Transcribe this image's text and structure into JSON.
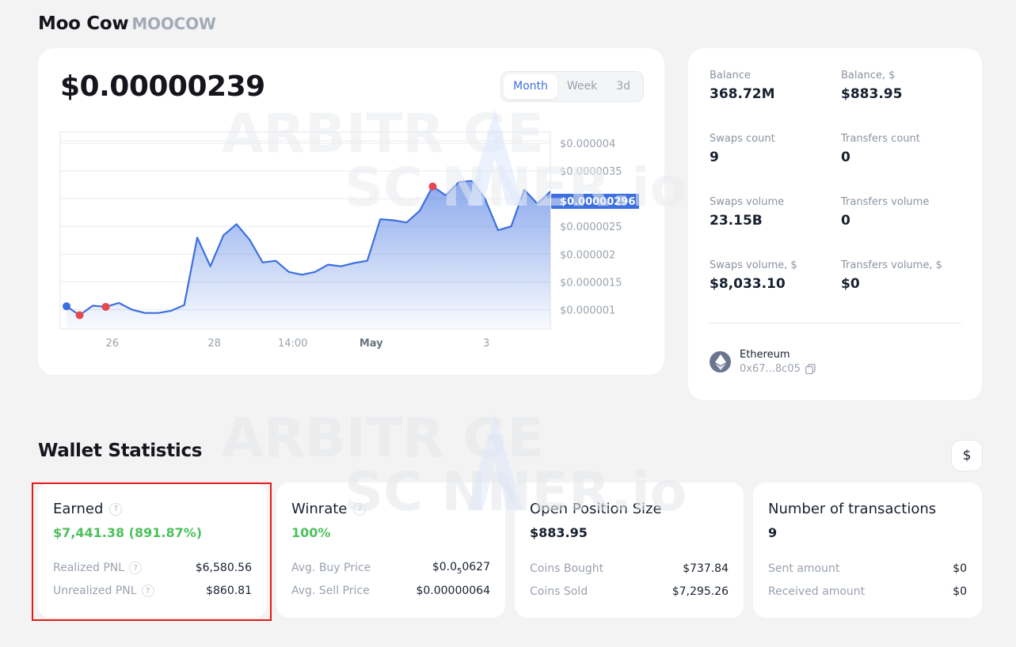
{
  "token": {
    "name": "Moo Cow",
    "symbol": "MOOCOW"
  },
  "price": "$0.00000239",
  "range_tabs": [
    "Month",
    "Week",
    "3d"
  ],
  "active_range": "Month",
  "watermark": {
    "line1": "ARBITR  GE",
    "line2": "SC  NNER.io"
  },
  "chart_data": {
    "type": "area",
    "x_tick_labels": [
      "26",
      "28",
      "14:00",
      "May",
      "3"
    ],
    "y_tick_labels": [
      "$0.000004",
      "$0.0000035",
      "$0.000003",
      "$0.0000025",
      "$0.000002",
      "$0.0000015",
      "$0.000001"
    ],
    "current_value_label": "$0.00000296",
    "ylim": [
      6.5e-07,
      4.2e-06
    ],
    "grid": true,
    "series": [
      {
        "values": [
          1.06e-06,
          9e-07,
          1.07e-06,
          1.05e-06,
          1.12e-06,
          1e-06,
          9.4e-07,
          9.4e-07,
          9.8e-07,
          1.08e-06,
          2.3e-06,
          1.78e-06,
          2.34e-06,
          2.54e-06,
          2.26e-06,
          1.85e-06,
          1.88e-06,
          1.68e-06,
          1.63e-06,
          1.68e-06,
          1.81e-06,
          1.78e-06,
          1.84e-06,
          1.88e-06,
          2.63e-06,
          2.61e-06,
          2.57e-06,
          2.78e-06,
          3.22e-06,
          3.06e-06,
          3.3e-06,
          3.32e-06,
          3e-06,
          2.43e-06,
          2.5e-06,
          3.16e-06,
          2.91e-06,
          3.13e-06
        ]
      }
    ],
    "markers": [
      {
        "index": 0,
        "value": 1.06e-06,
        "color": "#3c6fe0"
      },
      {
        "index": 1,
        "value": 9e-07,
        "color": "#e5484d"
      },
      {
        "index": 3,
        "value": 1.05e-06,
        "color": "#e5484d"
      },
      {
        "index": 28,
        "value": 3.22e-06,
        "color": "#e5484d"
      }
    ]
  },
  "stats": [
    {
      "label": "Balance",
      "value": "368.72M"
    },
    {
      "label": "Balance, $",
      "value": "$883.95"
    },
    {
      "label": "Swaps count",
      "value": "9"
    },
    {
      "label": "Transfers count",
      "value": "0"
    },
    {
      "label": "Swaps volume",
      "value": "23.15B"
    },
    {
      "label": "Transfers volume",
      "value": "0"
    },
    {
      "label": "Swaps volume, $",
      "value": "$8,033.10"
    },
    {
      "label": "Transfers volume, $",
      "value": "$0"
    }
  ],
  "network": {
    "name": "Ethereum",
    "address": "0x67...8c05"
  },
  "wallet_stats": {
    "title": "Wallet Statistics",
    "currency_button": "$",
    "cards": [
      {
        "title": "Earned",
        "value": "$7,441.38 (891.87%)",
        "rows": [
          {
            "label": "Realized PNL",
            "value": "$6,580.56"
          },
          {
            "label": "Unrealized PNL",
            "value": "$860.81"
          }
        ]
      },
      {
        "title": "Winrate",
        "value": "100%",
        "rows": [
          {
            "label": "Avg. Buy Price",
            "value_main": "$0.0",
            "value_sub": "5",
            "value_tail": "0627"
          },
          {
            "label": "Avg. Sell Price",
            "value": "$0.00000064"
          }
        ]
      },
      {
        "title": "Open Position Size",
        "value": "$883.95",
        "rows": [
          {
            "label": "Coins Bought",
            "value": "$737.84"
          },
          {
            "label": "Coins Sold",
            "value": "$7,295.26"
          }
        ]
      },
      {
        "title": "Number of transactions",
        "value": "9",
        "rows": [
          {
            "label": "Sent amount",
            "value": "$0"
          },
          {
            "label": "Received amount",
            "value": "$0"
          }
        ]
      }
    ]
  },
  "help_glyph": "?"
}
